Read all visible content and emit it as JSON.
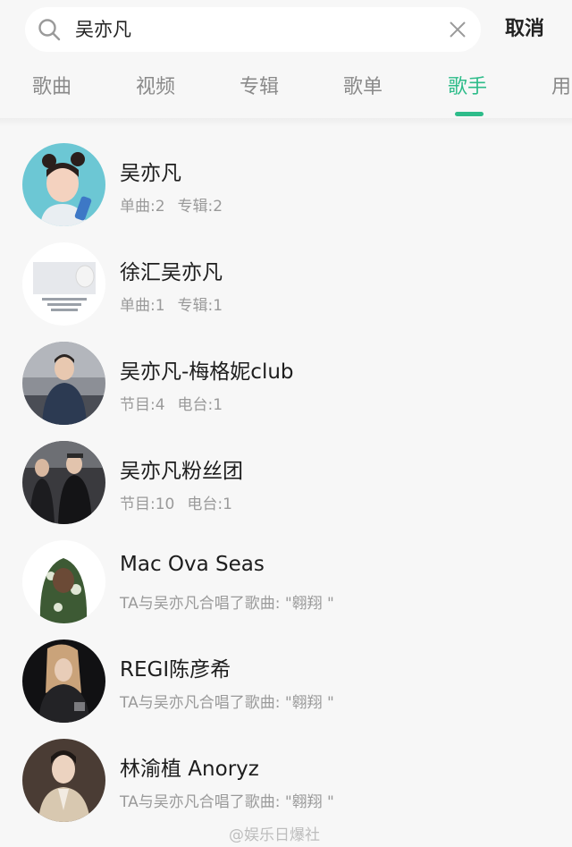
{
  "search": {
    "query": "吴亦凡",
    "cancel_label": "取消"
  },
  "tabs": [
    "歌曲",
    "视频",
    "专辑",
    "歌单",
    "歌手",
    "用"
  ],
  "active_tab_index": 4,
  "colors": {
    "accent": "#2ebc8a",
    "background": "#f7f7f7"
  },
  "results": [
    {
      "name": "吴亦凡",
      "meta": [
        "单曲:2",
        "专辑:2"
      ]
    },
    {
      "name": "徐汇吴亦凡",
      "meta": [
        "单曲:1",
        "专辑:1"
      ]
    },
    {
      "name": "吴亦凡-梅格妮club",
      "meta": [
        "节目:4",
        "电台:1"
      ]
    },
    {
      "name": "吴亦凡粉丝团",
      "meta": [
        "节目:10",
        "电台:1"
      ]
    },
    {
      "name": "Mac Ova Seas",
      "meta": [
        "TA与吴亦凡合唱了歌曲: \"翱翔 \""
      ]
    },
    {
      "name": "REGI陈彦希",
      "meta": [
        "TA与吴亦凡合唱了歌曲: \"翱翔 \""
      ]
    },
    {
      "name": "林渝植 Anoryz",
      "meta": [
        "TA与吴亦凡合唱了歌曲: \"翱翔 \""
      ]
    }
  ],
  "watermark": "@娱乐日爆社"
}
